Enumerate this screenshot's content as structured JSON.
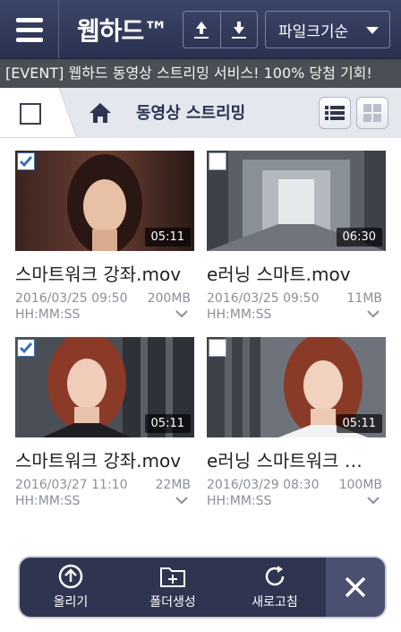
{
  "header": {
    "title": "웹하드™",
    "sort_dropdown": "파일크기순"
  },
  "banner": {
    "text": "[EVENT] 웹하드 동영상 스트리밍 서비스! 100% 당첨 기회!"
  },
  "breadcrumb": {
    "label": "동영상 스트리밍"
  },
  "items": [
    {
      "name": "스마트워크 강좌.mov",
      "date": "2016/03/25 09:50",
      "size": "200MB",
      "format": "HH:MM:SS",
      "duration": "05:11",
      "checked": true
    },
    {
      "name": "e러닝 스마트.mov",
      "date": "2016/03/25 09:50",
      "size": "11MB",
      "format": "HH:MM:SS",
      "duration": "06:30",
      "checked": false
    },
    {
      "name": "스마트워크 강좌.mov",
      "date": "2016/03/27 11:10",
      "size": "22MB",
      "format": "HH:MM:SS",
      "duration": "05:11",
      "checked": true
    },
    {
      "name": "e러닝 스마트워크 …",
      "date": "2016/03/29 08:30",
      "size": "100MB",
      "format": "HH:MM:SS",
      "duration": "05:11",
      "checked": false
    }
  ],
  "toolbar": {
    "upload": "올리기",
    "new_folder": "폴더생성",
    "refresh": "새로고침"
  },
  "colors": {
    "header": "#2f3550",
    "banner": "#4a4e55",
    "check": "#3a6fb3"
  }
}
